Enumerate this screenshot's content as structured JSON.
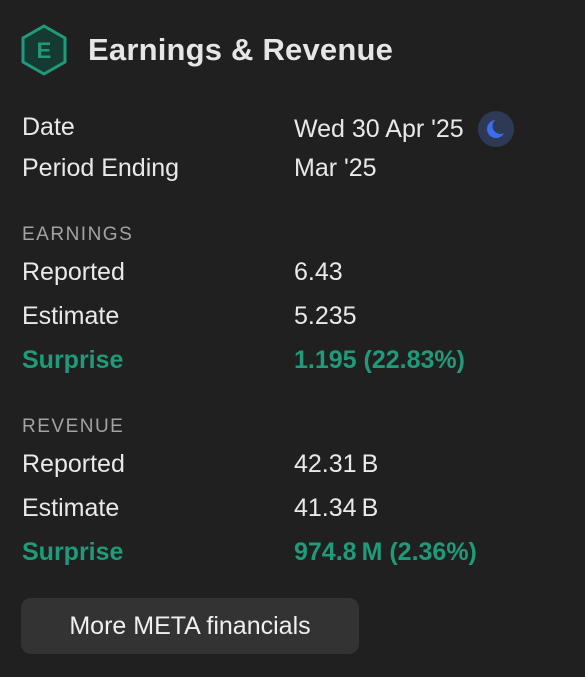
{
  "header": {
    "icon_letter": "E",
    "title": "Earnings & Revenue"
  },
  "summary": {
    "date_label": "Date",
    "date_value": "Wed 30 Apr '25",
    "date_badge_icon": "moon-icon",
    "period_label": "Period Ending",
    "period_value": "Mar '25"
  },
  "earnings": {
    "heading": "EARNINGS",
    "reported_label": "Reported",
    "reported_value": "6.43",
    "estimate_label": "Estimate",
    "estimate_value": "5.235",
    "surprise_label": "Surprise",
    "surprise_value": "1.195 (22.83%)"
  },
  "revenue": {
    "heading": "REVENUE",
    "reported_label": "Reported",
    "reported_value": "42.31 B",
    "estimate_label": "Estimate",
    "estimate_value": "41.34 B",
    "surprise_label": "Surprise",
    "surprise_value": "974.8 M (2.36%)"
  },
  "actions": {
    "more_button_label": "More META financials"
  },
  "colors": {
    "accent_green": "#1f9a7a",
    "moon_blue": "#3a6df0",
    "background": "#202020"
  }
}
